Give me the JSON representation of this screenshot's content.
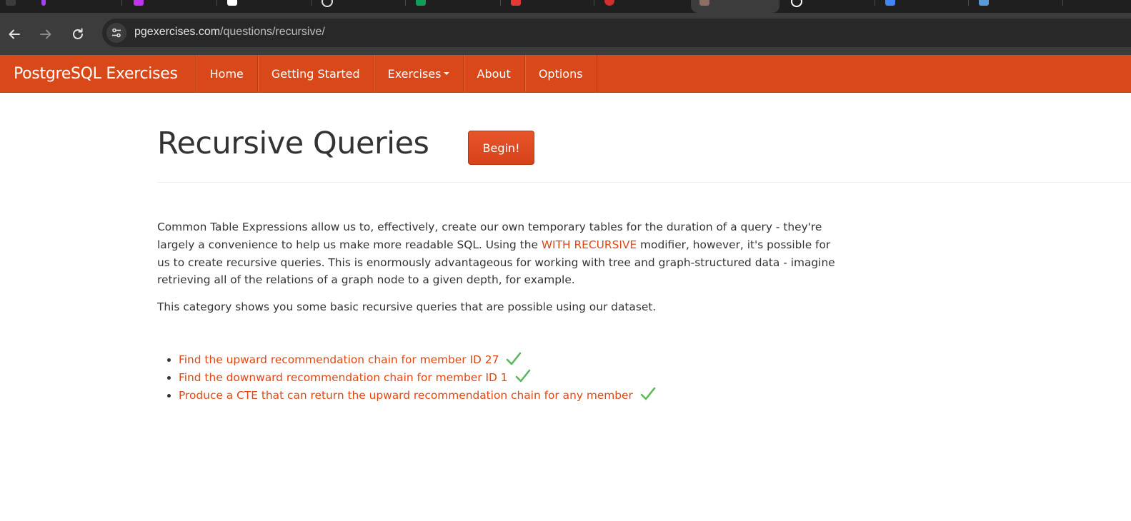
{
  "browser": {
    "url_host": "pgexercises.com",
    "url_path": "/questions/recursive/",
    "tab_favicon_colors": [
      "#a142f4",
      "#ffffff",
      "#ffffff",
      "#0f9d58",
      "#e53935",
      "#d32f2f",
      "#8d6e63",
      "#ffffff",
      "#4285f4",
      "#5b9bd5"
    ]
  },
  "site": {
    "brand": "PostgreSQL Exercises",
    "nav": {
      "home": "Home",
      "getting_started": "Getting Started",
      "exercises": "Exercises",
      "about": "About",
      "options": "Options"
    },
    "accent_color": "#dd4814"
  },
  "page": {
    "title": "Recursive Queries",
    "begin_label": "Begin!",
    "intro": {
      "part1": "Common Table Expressions allow us to, effectively, create our own temporary tables for the duration of a query - they're largely a convenience to help us make more readable SQL. Using the ",
      "keyword": "WITH RECURSIVE",
      "part2": " modifier, however, it's possible for us to create recursive queries. This is enormously advantageous for working with tree and graph-structured data - imagine retrieving all of the relations of a graph node to a given depth, for example."
    },
    "intro2": "This category shows you some basic recursive queries that are possible using our dataset.",
    "exercises": [
      {
        "label": "Find the upward recommendation chain for member ID 27",
        "completed": true
      },
      {
        "label": "Find the downward recommendation chain for member ID 1",
        "completed": true
      },
      {
        "label": "Produce a CTE that can return the upward recommendation chain for any member",
        "completed": true
      }
    ]
  }
}
